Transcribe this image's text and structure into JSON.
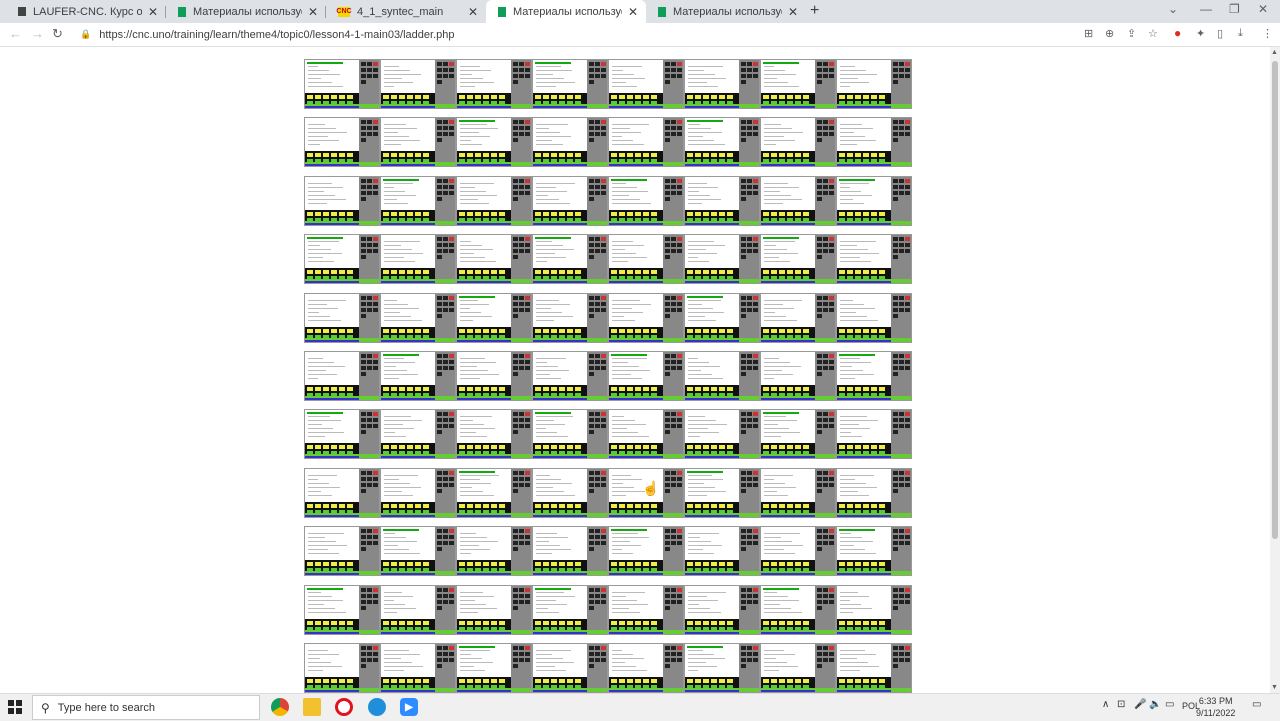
{
  "browser": {
    "tabs": [
      {
        "title": "LAUFER-CNC. Курс обучения Ст",
        "icon": "document-icon",
        "active": false
      },
      {
        "title": "Материалы используемые при",
        "icon": "sheets-icon",
        "active": false
      },
      {
        "title": "4_1_syntec_main",
        "icon": "cnc-icon",
        "favtext": "CNC",
        "active": false
      },
      {
        "title": "Материалы используемые при",
        "icon": "sheets-icon",
        "active": true
      },
      {
        "title": "Материалы используемые при",
        "icon": "sheets-icon",
        "active": false
      }
    ],
    "new_tab": "+",
    "url": "https://cnc.uno/training/learn/theme4/topic0/lesson4-1-main03/ladder.php"
  },
  "content": {
    "grid_rows": 11,
    "grid_cols": 8,
    "thumbnail_icon": "cnc-controller-screenshot-icon"
  },
  "taskbar": {
    "search_placeholder": "Type here to search",
    "language": "POL",
    "time": "6:33 PM",
    "date": "9/11/2022"
  },
  "colors": {
    "tabbar_bg": "#dee1e6",
    "accent_green": "#66cc33",
    "panel_yellow": "#eeee44",
    "sheets_green": "#0f9d58"
  }
}
